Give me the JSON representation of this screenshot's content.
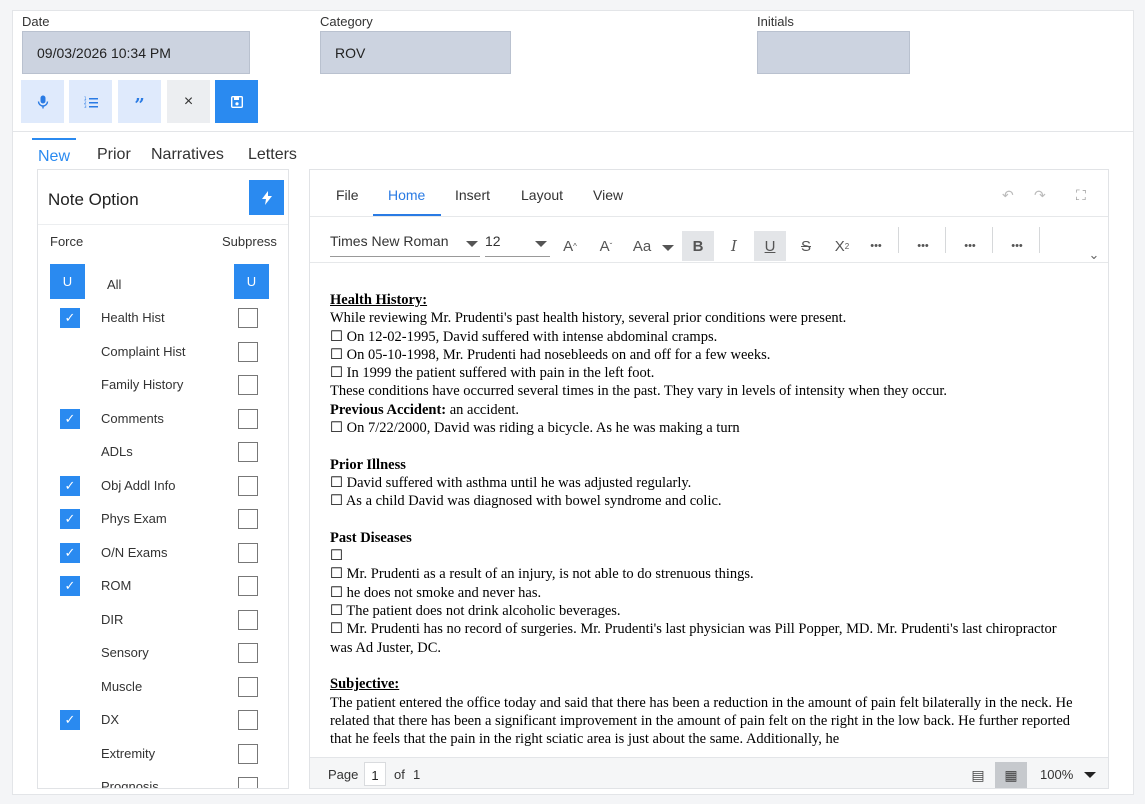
{
  "header": {
    "date_label": "Date",
    "date_value": "09/03/2026 10:34 PM",
    "category_label": "Category",
    "category_value": "ROV",
    "initials_label": "Initials",
    "initials_value": ""
  },
  "toolbar": {
    "mic_icon": "microphone-icon",
    "list_icon": "numbered-list-icon",
    "quote_icon": "quote-icon",
    "close_label": "×",
    "save_icon": "save-icon"
  },
  "tabs": [
    {
      "label": "New"
    },
    {
      "label": "Prior"
    },
    {
      "label": "Narratives"
    },
    {
      "label": "Letters"
    }
  ],
  "note_option": {
    "title": "Note Option",
    "force_label": "Force",
    "subpress_label": "Subpress",
    "u_label": "U",
    "all_label": "All",
    "check_glyph": "✓",
    "items": [
      {
        "label": "Health Hist",
        "force": true
      },
      {
        "label": "Complaint Hist",
        "force": false
      },
      {
        "label": "Family History",
        "force": false
      },
      {
        "label": "Comments",
        "force": true
      },
      {
        "label": "ADLs",
        "force": false
      },
      {
        "label": "Obj Addl Info",
        "force": true
      },
      {
        "label": "Phys Exam",
        "force": true
      },
      {
        "label": "O/N Exams",
        "force": true
      },
      {
        "label": "ROM",
        "force": true
      },
      {
        "label": "DIR",
        "force": false
      },
      {
        "label": "Sensory",
        "force": false
      },
      {
        "label": "Muscle",
        "force": false
      },
      {
        "label": "DX",
        "force": true
      },
      {
        "label": "Extremity",
        "force": false
      },
      {
        "label": "Prognosis",
        "force": false
      }
    ]
  },
  "editor": {
    "menu": [
      "File",
      "Home",
      "Insert",
      "Layout",
      "View"
    ],
    "font_family": "Times New Roman",
    "font_size": "12",
    "more": "•••",
    "doc": {
      "h1": "Health History:",
      "p1": "While reviewing Mr. Prudenti's past health history, several prior conditions were present.",
      "l1": " On 12-02-1995, David suffered with intense abdominal cramps.",
      "l2": " On 05-10-1998, Mr. Prudenti had nosebleeds on and off for a few weeks.",
      "l3": " In 1999 the patient suffered with pain in the left foot.",
      "p2": "These conditions have occurred several times in the past. They vary in levels of intensity when they occur.",
      "h2": "Previous Accident:",
      "p3": " an accident.",
      "l4": " On 7/22/2000, David was riding a bicycle. As he was making a turn",
      "h3": "Prior Illness",
      "l5": " David suffered with asthma until he was adjusted regularly.",
      "l6": " As a child David was diagnosed with bowel syndrome and colic.",
      "h4": "Past Diseases",
      "l7": "",
      "l8": " Mr. Prudenti as a result of an injury, is not able to do strenuous things.",
      "l9": " he does not smoke and never has.",
      "l10": " The patient does not drink alcoholic beverages.",
      "l11": " Mr. Prudenti has no record of surgeries. Mr. Prudenti's last physician was Pill Popper, MD. Mr. Prudenti's last chiropractor was Ad Juster, DC.",
      "h5": "Subjective:",
      "p4": "The patient entered the office today and said that there has been a reduction in the amount of pain felt bilaterally in the neck. He related that there has been a significant improvement in the amount of pain felt on the right in the low back. He further reported that he feels that the pain in the right sciatic area is just about the same. Additionally, he"
    },
    "status": {
      "page_label": "Page",
      "page_value": "1",
      "of_label": "of",
      "total_pages": "1",
      "zoom": "100%"
    }
  }
}
